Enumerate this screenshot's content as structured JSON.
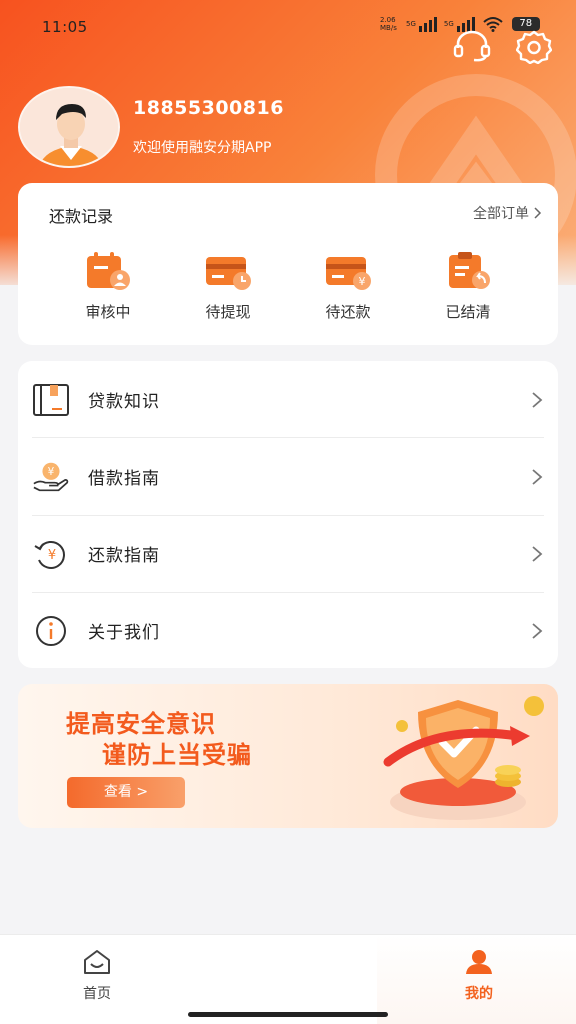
{
  "status_bar": {
    "time": "11:05",
    "net_speed_value": "2.06",
    "net_speed_unit": "MB/s",
    "signal_1": "5G",
    "signal_2": "5G",
    "battery": "78"
  },
  "profile": {
    "phone": "18855300816",
    "welcome": "欢迎使用融安分期APP"
  },
  "repay_records": {
    "title": "还款记录",
    "all_orders": "全部订单",
    "items": [
      {
        "label": "审核中",
        "icon": "review-icon"
      },
      {
        "label": "待提现",
        "icon": "withdraw-icon"
      },
      {
        "label": "待还款",
        "icon": "repay-card-icon"
      },
      {
        "label": "已结清",
        "icon": "settled-icon"
      }
    ]
  },
  "menu": [
    {
      "label": "贷款知识",
      "icon": "book-icon"
    },
    {
      "label": "借款指南",
      "icon": "coin-hand-icon"
    },
    {
      "label": "还款指南",
      "icon": "refund-icon"
    },
    {
      "label": "关于我们",
      "icon": "info-icon"
    }
  ],
  "banner": {
    "line1": "提高安全意识",
    "line2": "谨防上当受骗",
    "button": "查看 >"
  },
  "tabbar": {
    "home": "首页",
    "mine": "我的"
  },
  "colors": {
    "accent": "#f3621f",
    "hero_start": "#f7521f",
    "hero_end": "#fbb07a"
  }
}
